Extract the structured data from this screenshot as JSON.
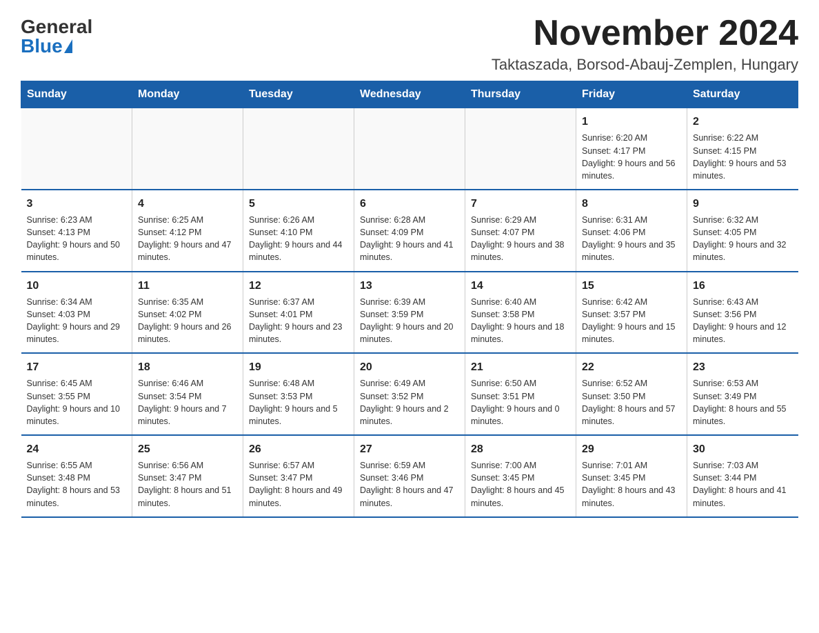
{
  "header": {
    "logo_general": "General",
    "logo_blue": "Blue",
    "title": "November 2024",
    "subtitle": "Taktaszada, Borsod-Abauj-Zemplen, Hungary"
  },
  "calendar": {
    "days_of_week": [
      "Sunday",
      "Monday",
      "Tuesday",
      "Wednesday",
      "Thursday",
      "Friday",
      "Saturday"
    ],
    "weeks": [
      [
        {
          "day": "",
          "info": ""
        },
        {
          "day": "",
          "info": ""
        },
        {
          "day": "",
          "info": ""
        },
        {
          "day": "",
          "info": ""
        },
        {
          "day": "",
          "info": ""
        },
        {
          "day": "1",
          "info": "Sunrise: 6:20 AM\nSunset: 4:17 PM\nDaylight: 9 hours and 56 minutes."
        },
        {
          "day": "2",
          "info": "Sunrise: 6:22 AM\nSunset: 4:15 PM\nDaylight: 9 hours and 53 minutes."
        }
      ],
      [
        {
          "day": "3",
          "info": "Sunrise: 6:23 AM\nSunset: 4:13 PM\nDaylight: 9 hours and 50 minutes."
        },
        {
          "day": "4",
          "info": "Sunrise: 6:25 AM\nSunset: 4:12 PM\nDaylight: 9 hours and 47 minutes."
        },
        {
          "day": "5",
          "info": "Sunrise: 6:26 AM\nSunset: 4:10 PM\nDaylight: 9 hours and 44 minutes."
        },
        {
          "day": "6",
          "info": "Sunrise: 6:28 AM\nSunset: 4:09 PM\nDaylight: 9 hours and 41 minutes."
        },
        {
          "day": "7",
          "info": "Sunrise: 6:29 AM\nSunset: 4:07 PM\nDaylight: 9 hours and 38 minutes."
        },
        {
          "day": "8",
          "info": "Sunrise: 6:31 AM\nSunset: 4:06 PM\nDaylight: 9 hours and 35 minutes."
        },
        {
          "day": "9",
          "info": "Sunrise: 6:32 AM\nSunset: 4:05 PM\nDaylight: 9 hours and 32 minutes."
        }
      ],
      [
        {
          "day": "10",
          "info": "Sunrise: 6:34 AM\nSunset: 4:03 PM\nDaylight: 9 hours and 29 minutes."
        },
        {
          "day": "11",
          "info": "Sunrise: 6:35 AM\nSunset: 4:02 PM\nDaylight: 9 hours and 26 minutes."
        },
        {
          "day": "12",
          "info": "Sunrise: 6:37 AM\nSunset: 4:01 PM\nDaylight: 9 hours and 23 minutes."
        },
        {
          "day": "13",
          "info": "Sunrise: 6:39 AM\nSunset: 3:59 PM\nDaylight: 9 hours and 20 minutes."
        },
        {
          "day": "14",
          "info": "Sunrise: 6:40 AM\nSunset: 3:58 PM\nDaylight: 9 hours and 18 minutes."
        },
        {
          "day": "15",
          "info": "Sunrise: 6:42 AM\nSunset: 3:57 PM\nDaylight: 9 hours and 15 minutes."
        },
        {
          "day": "16",
          "info": "Sunrise: 6:43 AM\nSunset: 3:56 PM\nDaylight: 9 hours and 12 minutes."
        }
      ],
      [
        {
          "day": "17",
          "info": "Sunrise: 6:45 AM\nSunset: 3:55 PM\nDaylight: 9 hours and 10 minutes."
        },
        {
          "day": "18",
          "info": "Sunrise: 6:46 AM\nSunset: 3:54 PM\nDaylight: 9 hours and 7 minutes."
        },
        {
          "day": "19",
          "info": "Sunrise: 6:48 AM\nSunset: 3:53 PM\nDaylight: 9 hours and 5 minutes."
        },
        {
          "day": "20",
          "info": "Sunrise: 6:49 AM\nSunset: 3:52 PM\nDaylight: 9 hours and 2 minutes."
        },
        {
          "day": "21",
          "info": "Sunrise: 6:50 AM\nSunset: 3:51 PM\nDaylight: 9 hours and 0 minutes."
        },
        {
          "day": "22",
          "info": "Sunrise: 6:52 AM\nSunset: 3:50 PM\nDaylight: 8 hours and 57 minutes."
        },
        {
          "day": "23",
          "info": "Sunrise: 6:53 AM\nSunset: 3:49 PM\nDaylight: 8 hours and 55 minutes."
        }
      ],
      [
        {
          "day": "24",
          "info": "Sunrise: 6:55 AM\nSunset: 3:48 PM\nDaylight: 8 hours and 53 minutes."
        },
        {
          "day": "25",
          "info": "Sunrise: 6:56 AM\nSunset: 3:47 PM\nDaylight: 8 hours and 51 minutes."
        },
        {
          "day": "26",
          "info": "Sunrise: 6:57 AM\nSunset: 3:47 PM\nDaylight: 8 hours and 49 minutes."
        },
        {
          "day": "27",
          "info": "Sunrise: 6:59 AM\nSunset: 3:46 PM\nDaylight: 8 hours and 47 minutes."
        },
        {
          "day": "28",
          "info": "Sunrise: 7:00 AM\nSunset: 3:45 PM\nDaylight: 8 hours and 45 minutes."
        },
        {
          "day": "29",
          "info": "Sunrise: 7:01 AM\nSunset: 3:45 PM\nDaylight: 8 hours and 43 minutes."
        },
        {
          "day": "30",
          "info": "Sunrise: 7:03 AM\nSunset: 3:44 PM\nDaylight: 8 hours and 41 minutes."
        }
      ]
    ]
  }
}
